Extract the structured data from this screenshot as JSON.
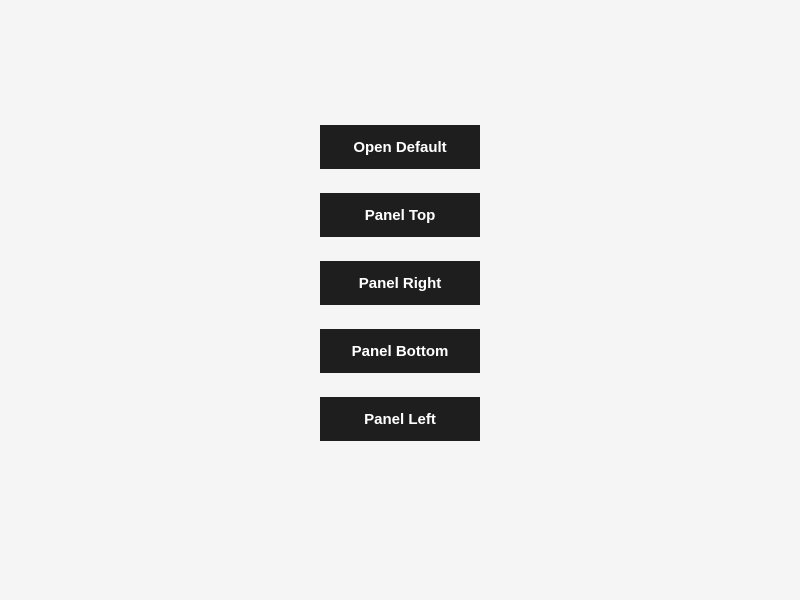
{
  "buttons": [
    {
      "label": "Open Default"
    },
    {
      "label": "Panel Top"
    },
    {
      "label": "Panel Right"
    },
    {
      "label": "Panel Bottom"
    },
    {
      "label": "Panel Left"
    }
  ]
}
